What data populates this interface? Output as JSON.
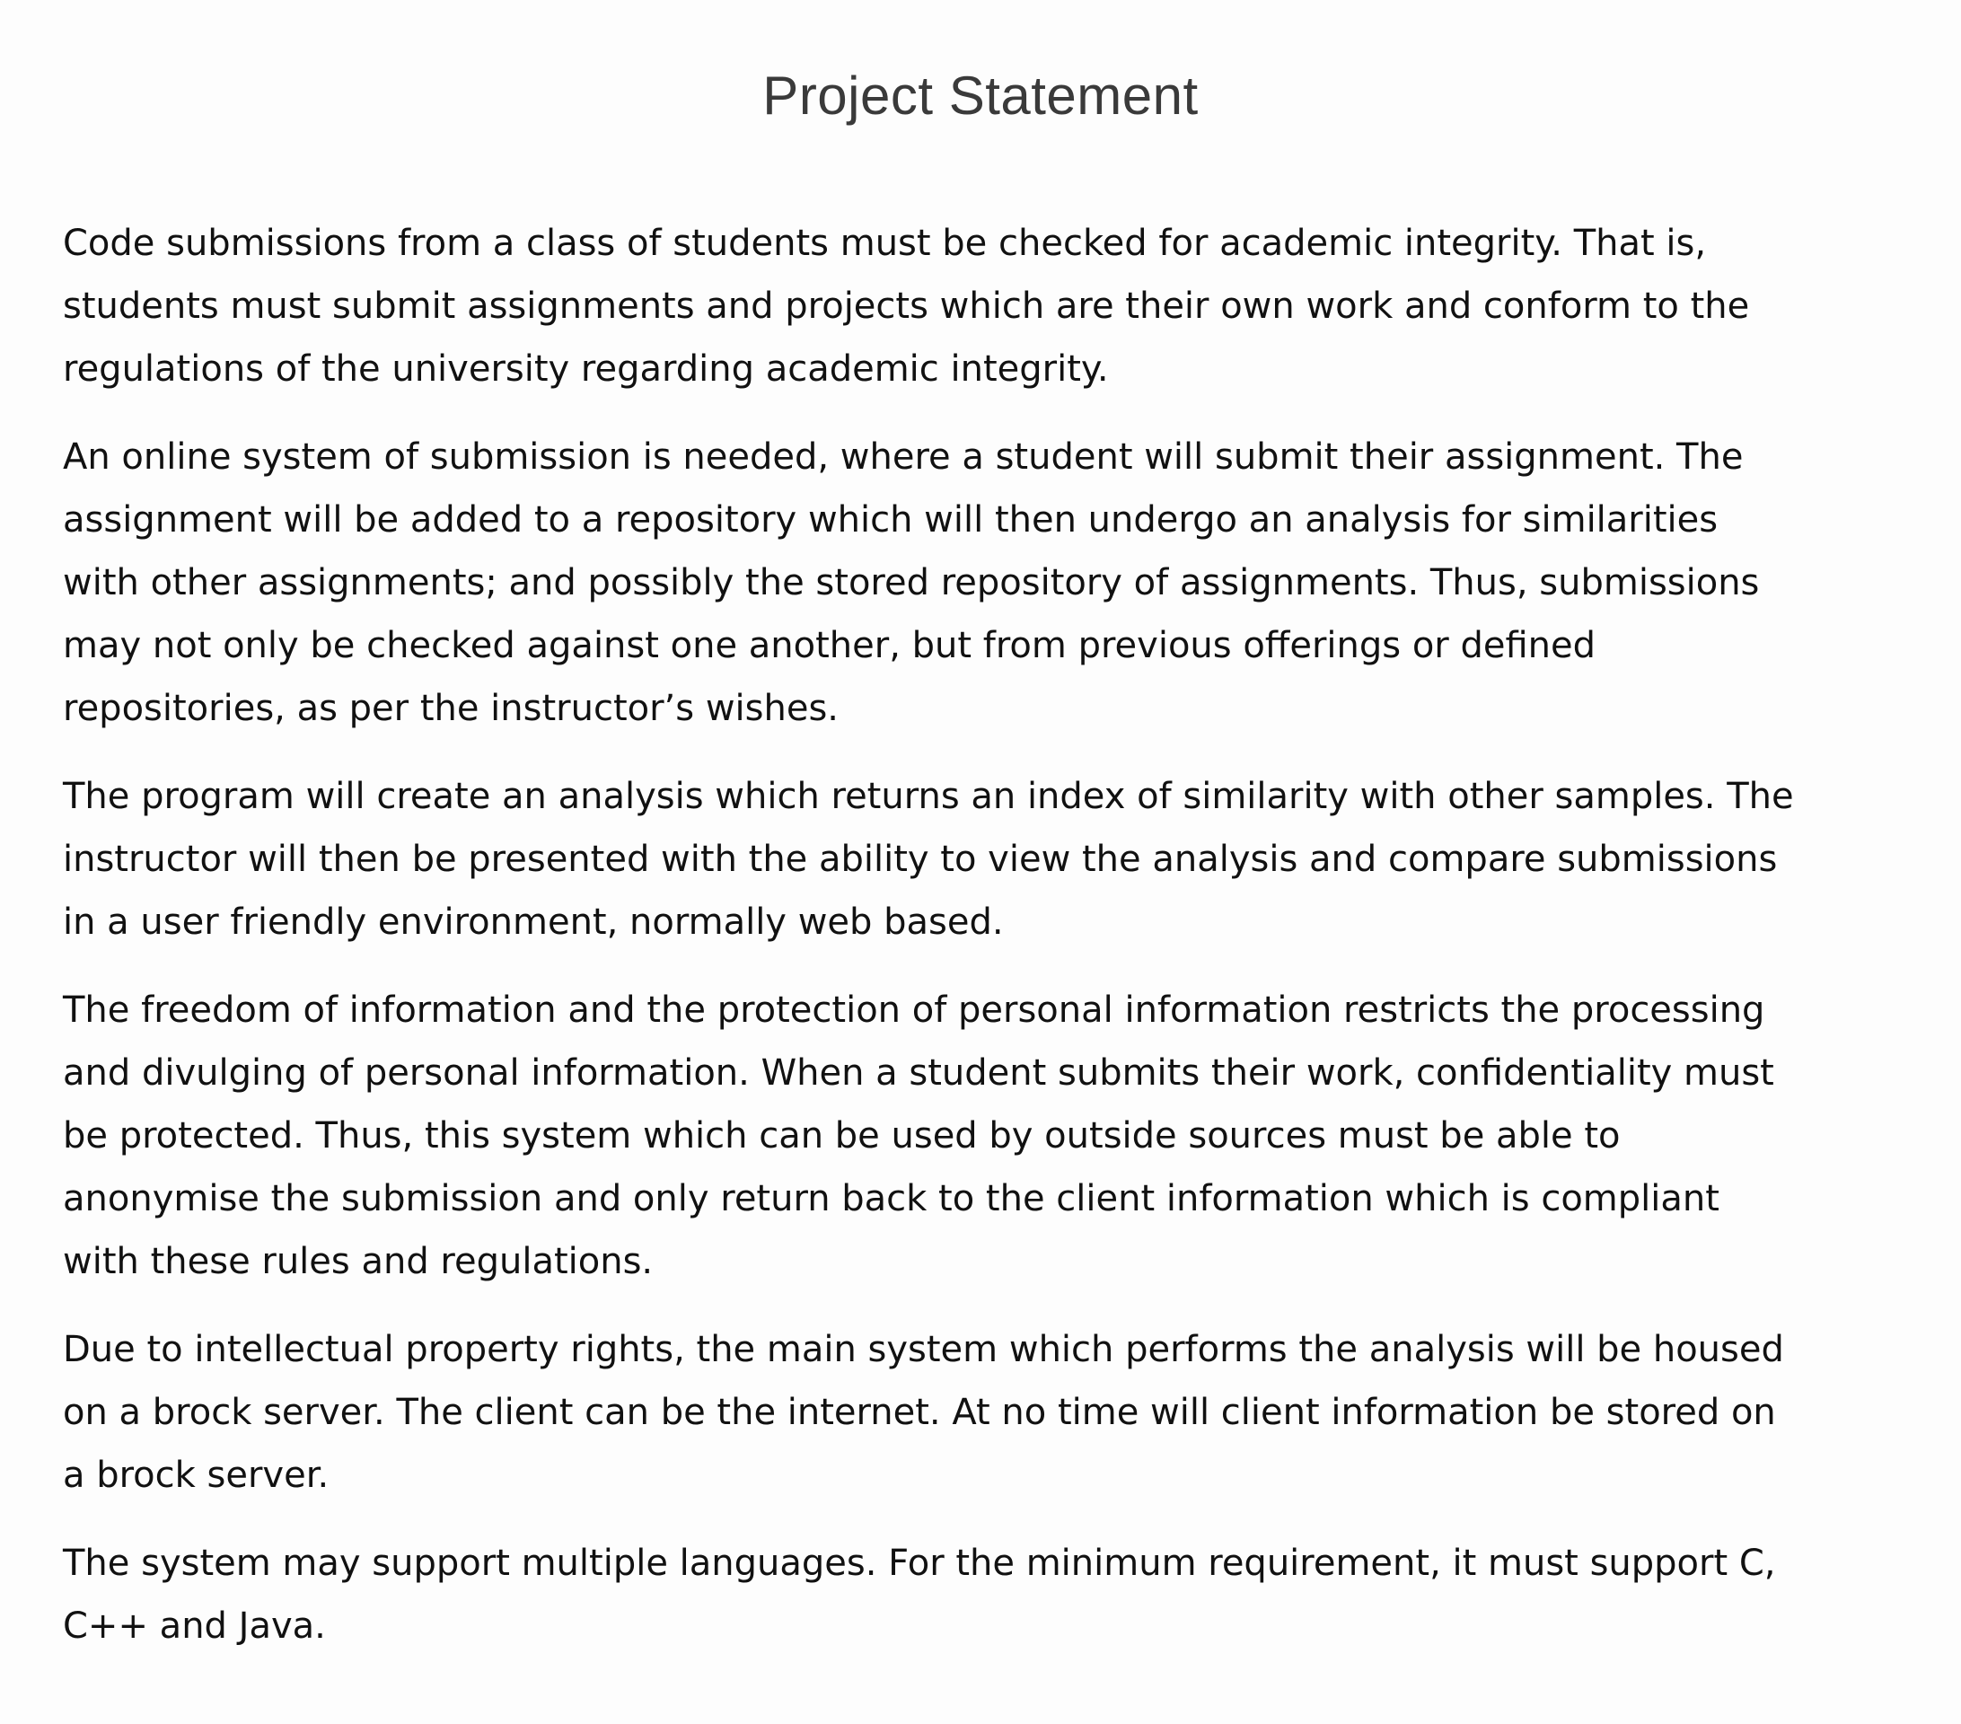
{
  "document": {
    "title": "Project Statement",
    "paragraphs": [
      {
        "lines": [
          "Code submissions from a class of students must be checked for academic integrity. That is,",
          "students must submit assignments and projects which are their own work and conform to the",
          "regulations of the university regarding academic integrity."
        ]
      },
      {
        "lines": [
          "An online system of submission is needed, where a student will submit their assignment. The",
          "assignment will be added to a repository which will then undergo an analysis for similarities",
          "with other assignments; and possibly the stored repository of assignments. Thus, submissions",
          "may not only be checked against one another, but from previous offerings or defined",
          "repositories, as per the instructor’s wishes."
        ]
      },
      {
        "lines": [
          "The program will create an analysis which returns an index of similarity with other samples. The",
          "instructor will then be presented with the ability to view the analysis and compare submissions",
          "in a user friendly environment, normally web based."
        ]
      },
      {
        "lines": [
          "The freedom of information and the protection of personal information restricts the processing",
          "and divulging of personal information. When a student submits their work, confidentiality must",
          "be protected. Thus, this system which can be used by outside sources must be able to",
          "anonymise the submission and only return back to the client information which is compliant",
          "with these rules and regulations."
        ]
      },
      {
        "lines": [
          "Due to intellectual property rights, the main system which performs the analysis will be housed",
          "on a brock server. The client can be the internet. At no time will client information be stored on",
          "a brock server."
        ]
      },
      {
        "lines": [
          "The system may support multiple languages. For the minimum requirement, it must support C,",
          "C++ and Java."
        ]
      }
    ]
  }
}
